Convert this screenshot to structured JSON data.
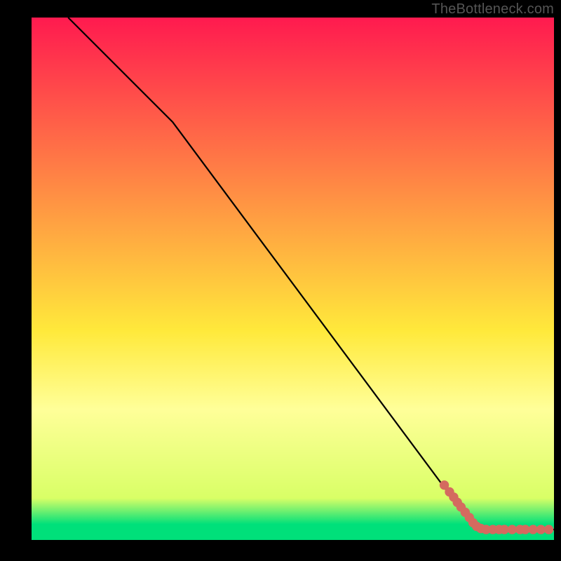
{
  "watermark": "TheBottleneck.com",
  "colors": {
    "red": "#ff1a4f",
    "yellow": "#ffe93b",
    "green": "#00e07a",
    "line": "#000000",
    "marker": "#d46a5f",
    "frame": "#000000"
  },
  "chart_data": {
    "type": "line",
    "title": "",
    "xlabel": "",
    "ylabel": "",
    "xlim": [
      0,
      100
    ],
    "ylim": [
      0,
      100
    ],
    "gradient_stops": [
      {
        "y": 100,
        "color": "#ff1a4f"
      },
      {
        "y": 40,
        "color": "#ffe93b"
      },
      {
        "y": 25,
        "color": "#ffff99"
      },
      {
        "y": 8,
        "color": "#d9ff66"
      },
      {
        "y": 3,
        "color": "#00e07a"
      },
      {
        "y": 0,
        "color": "#00e07a"
      }
    ],
    "series": [
      {
        "name": "bottleneck-curve",
        "x": [
          7,
          27,
          85,
          100
        ],
        "y": [
          100,
          80,
          2,
          2
        ]
      }
    ],
    "markers": {
      "name": "data-points",
      "points": [
        {
          "x": 79,
          "y": 10.5
        },
        {
          "x": 80,
          "y": 9.2
        },
        {
          "x": 80.8,
          "y": 8.2
        },
        {
          "x": 81.5,
          "y": 7.2
        },
        {
          "x": 82.2,
          "y": 6.3
        },
        {
          "x": 83,
          "y": 5.3
        },
        {
          "x": 83.8,
          "y": 4.3
        },
        {
          "x": 84.5,
          "y": 3.3
        },
        {
          "x": 85.2,
          "y": 2.6
        },
        {
          "x": 86,
          "y": 2.2
        },
        {
          "x": 87,
          "y": 2.0
        },
        {
          "x": 88.3,
          "y": 2.0
        },
        {
          "x": 89.5,
          "y": 2.0
        },
        {
          "x": 90.5,
          "y": 2.0
        },
        {
          "x": 92,
          "y": 2.0
        },
        {
          "x": 93.5,
          "y": 2.0
        },
        {
          "x": 94.5,
          "y": 2.0
        },
        {
          "x": 96,
          "y": 2.0
        },
        {
          "x": 97.5,
          "y": 2.0
        },
        {
          "x": 99,
          "y": 2.0
        }
      ]
    }
  }
}
